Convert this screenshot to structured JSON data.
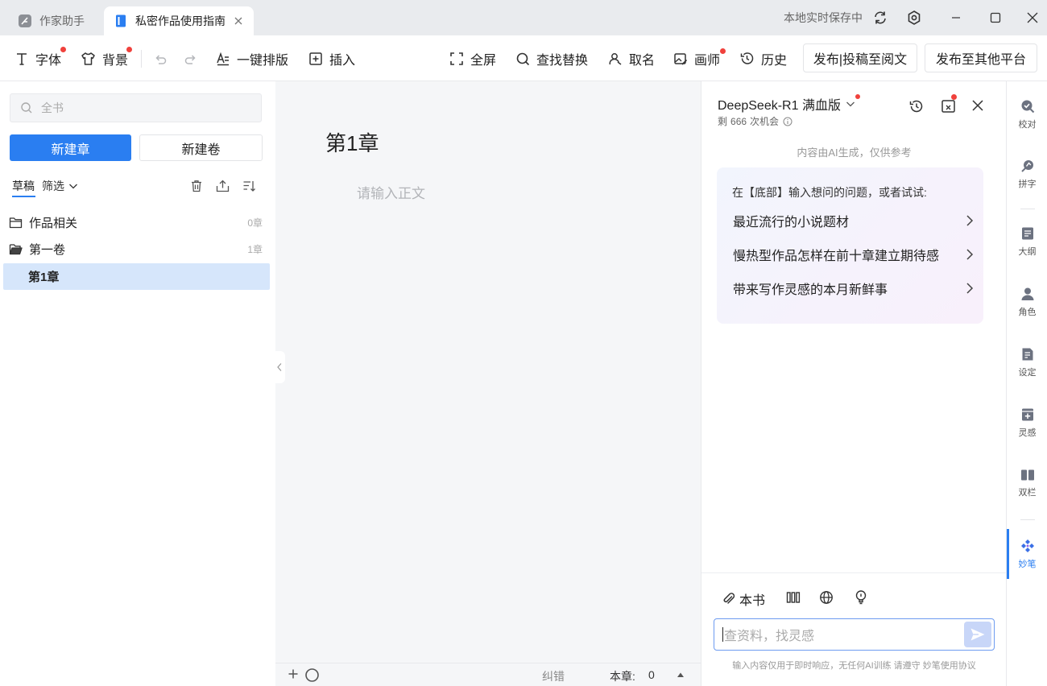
{
  "tabs": [
    {
      "label": "作家助手",
      "icon": "feather-icon"
    },
    {
      "label": "私密作品使用指南",
      "icon": "book-icon"
    }
  ],
  "titlebar": {
    "save_status": "本地实时保存中"
  },
  "toolbar": {
    "font": "字体",
    "background": "背景",
    "format": "一键排版",
    "insert": "插入",
    "fullscreen": "全屏",
    "find_replace": "查找替换",
    "naming": "取名",
    "painter": "画师",
    "history": "历史",
    "publish_yuewen": "发布|投稿至阅文",
    "publish_other": "发布至其他平台"
  },
  "left": {
    "search_placeholder": "全书",
    "new_chapter": "新建章",
    "new_volume": "新建卷",
    "tab_draft": "草稿",
    "filter": "筛选",
    "tree": [
      {
        "label": "作品相关",
        "count": "0章"
      },
      {
        "label": "第一卷",
        "count": "1章"
      },
      {
        "label": "第1章",
        "count": ""
      }
    ]
  },
  "editor": {
    "chapter_title": "第1章",
    "body_placeholder": "请输入正文",
    "correct": "纠错",
    "chapter_count_label": "本章:",
    "chapter_count": "0"
  },
  "ai": {
    "model": "DeepSeek-R1 满血版",
    "remaining_prefix": "剩",
    "remaining": "666",
    "remaining_suffix": "次机会",
    "disclaimer": "内容由AI生成，仅供参考",
    "prompt_intro": "在【底部】输入想问的问题，或者试试:",
    "suggestions": [
      "最近流行的小说题材",
      "慢热型作品怎样在前十章建立期待感",
      "带来写作灵感的本月新鲜事"
    ],
    "attach_label": "本书",
    "input_placeholder": "查资料，找灵感",
    "footer_note": "输入内容仅用于即时响应，无任何AI训练 请遵守 妙笔使用协议"
  },
  "rightbar": [
    {
      "label": "校对",
      "icon": "proofread-icon"
    },
    {
      "label": "拼字",
      "icon": "spell-icon"
    },
    {
      "label": "大纲",
      "icon": "outline-icon"
    },
    {
      "label": "角色",
      "icon": "character-icon"
    },
    {
      "label": "设定",
      "icon": "settings-doc-icon"
    },
    {
      "label": "灵感",
      "icon": "inspiration-icon"
    },
    {
      "label": "双栏",
      "icon": "dual-column-icon"
    },
    {
      "label": "妙笔",
      "icon": "miaobi-icon"
    }
  ],
  "colors": {
    "accent": "#2a7ef1",
    "red_dot": "#f0413c",
    "selected_row": "#d6e6fb"
  }
}
